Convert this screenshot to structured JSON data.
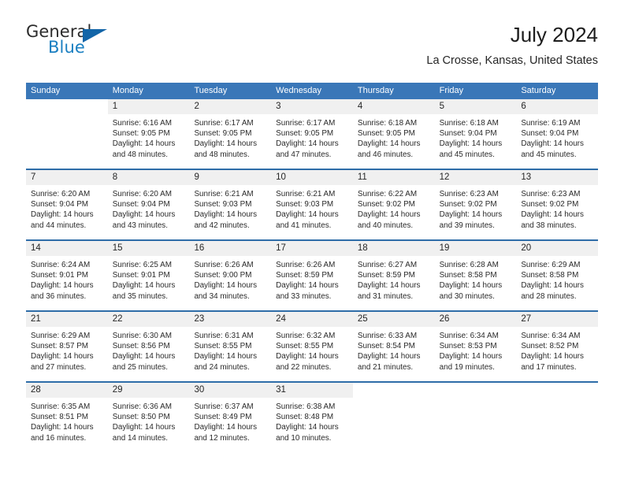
{
  "brand": {
    "name_primary": "General",
    "name_secondary": "Blue",
    "logo_icon": "triangle-logo-icon"
  },
  "header": {
    "title": "July 2024",
    "subtitle": "La Crosse, Kansas, United States"
  },
  "colors": {
    "header_blue": "#3a77b8",
    "row_divider_blue": "#2e6da8",
    "day_band_gray": "#f0f0f0",
    "logo_blue": "#1a7fc1",
    "text_dark": "#262626"
  },
  "weekdays": [
    "Sunday",
    "Monday",
    "Tuesday",
    "Wednesday",
    "Thursday",
    "Friday",
    "Saturday"
  ],
  "weeks": [
    {
      "days": [
        {
          "number": "",
          "blank": true,
          "lines": []
        },
        {
          "number": "1",
          "blank": false,
          "lines": [
            "Sunrise: 6:16 AM",
            "Sunset: 9:05 PM",
            "Daylight: 14 hours",
            "and 48 minutes."
          ]
        },
        {
          "number": "2",
          "blank": false,
          "lines": [
            "Sunrise: 6:17 AM",
            "Sunset: 9:05 PM",
            "Daylight: 14 hours",
            "and 48 minutes."
          ]
        },
        {
          "number": "3",
          "blank": false,
          "lines": [
            "Sunrise: 6:17 AM",
            "Sunset: 9:05 PM",
            "Daylight: 14 hours",
            "and 47 minutes."
          ]
        },
        {
          "number": "4",
          "blank": false,
          "lines": [
            "Sunrise: 6:18 AM",
            "Sunset: 9:05 PM",
            "Daylight: 14 hours",
            "and 46 minutes."
          ]
        },
        {
          "number": "5",
          "blank": false,
          "lines": [
            "Sunrise: 6:18 AM",
            "Sunset: 9:04 PM",
            "Daylight: 14 hours",
            "and 45 minutes."
          ]
        },
        {
          "number": "6",
          "blank": false,
          "lines": [
            "Sunrise: 6:19 AM",
            "Sunset: 9:04 PM",
            "Daylight: 14 hours",
            "and 45 minutes."
          ]
        }
      ]
    },
    {
      "days": [
        {
          "number": "7",
          "blank": false,
          "lines": [
            "Sunrise: 6:20 AM",
            "Sunset: 9:04 PM",
            "Daylight: 14 hours",
            "and 44 minutes."
          ]
        },
        {
          "number": "8",
          "blank": false,
          "lines": [
            "Sunrise: 6:20 AM",
            "Sunset: 9:04 PM",
            "Daylight: 14 hours",
            "and 43 minutes."
          ]
        },
        {
          "number": "9",
          "blank": false,
          "lines": [
            "Sunrise: 6:21 AM",
            "Sunset: 9:03 PM",
            "Daylight: 14 hours",
            "and 42 minutes."
          ]
        },
        {
          "number": "10",
          "blank": false,
          "lines": [
            "Sunrise: 6:21 AM",
            "Sunset: 9:03 PM",
            "Daylight: 14 hours",
            "and 41 minutes."
          ]
        },
        {
          "number": "11",
          "blank": false,
          "lines": [
            "Sunrise: 6:22 AM",
            "Sunset: 9:02 PM",
            "Daylight: 14 hours",
            "and 40 minutes."
          ]
        },
        {
          "number": "12",
          "blank": false,
          "lines": [
            "Sunrise: 6:23 AM",
            "Sunset: 9:02 PM",
            "Daylight: 14 hours",
            "and 39 minutes."
          ]
        },
        {
          "number": "13",
          "blank": false,
          "lines": [
            "Sunrise: 6:23 AM",
            "Sunset: 9:02 PM",
            "Daylight: 14 hours",
            "and 38 minutes."
          ]
        }
      ]
    },
    {
      "days": [
        {
          "number": "14",
          "blank": false,
          "lines": [
            "Sunrise: 6:24 AM",
            "Sunset: 9:01 PM",
            "Daylight: 14 hours",
            "and 36 minutes."
          ]
        },
        {
          "number": "15",
          "blank": false,
          "lines": [
            "Sunrise: 6:25 AM",
            "Sunset: 9:01 PM",
            "Daylight: 14 hours",
            "and 35 minutes."
          ]
        },
        {
          "number": "16",
          "blank": false,
          "lines": [
            "Sunrise: 6:26 AM",
            "Sunset: 9:00 PM",
            "Daylight: 14 hours",
            "and 34 minutes."
          ]
        },
        {
          "number": "17",
          "blank": false,
          "lines": [
            "Sunrise: 6:26 AM",
            "Sunset: 8:59 PM",
            "Daylight: 14 hours",
            "and 33 minutes."
          ]
        },
        {
          "number": "18",
          "blank": false,
          "lines": [
            "Sunrise: 6:27 AM",
            "Sunset: 8:59 PM",
            "Daylight: 14 hours",
            "and 31 minutes."
          ]
        },
        {
          "number": "19",
          "blank": false,
          "lines": [
            "Sunrise: 6:28 AM",
            "Sunset: 8:58 PM",
            "Daylight: 14 hours",
            "and 30 minutes."
          ]
        },
        {
          "number": "20",
          "blank": false,
          "lines": [
            "Sunrise: 6:29 AM",
            "Sunset: 8:58 PM",
            "Daylight: 14 hours",
            "and 28 minutes."
          ]
        }
      ]
    },
    {
      "days": [
        {
          "number": "21",
          "blank": false,
          "lines": [
            "Sunrise: 6:29 AM",
            "Sunset: 8:57 PM",
            "Daylight: 14 hours",
            "and 27 minutes."
          ]
        },
        {
          "number": "22",
          "blank": false,
          "lines": [
            "Sunrise: 6:30 AM",
            "Sunset: 8:56 PM",
            "Daylight: 14 hours",
            "and 25 minutes."
          ]
        },
        {
          "number": "23",
          "blank": false,
          "lines": [
            "Sunrise: 6:31 AM",
            "Sunset: 8:55 PM",
            "Daylight: 14 hours",
            "and 24 minutes."
          ]
        },
        {
          "number": "24",
          "blank": false,
          "lines": [
            "Sunrise: 6:32 AM",
            "Sunset: 8:55 PM",
            "Daylight: 14 hours",
            "and 22 minutes."
          ]
        },
        {
          "number": "25",
          "blank": false,
          "lines": [
            "Sunrise: 6:33 AM",
            "Sunset: 8:54 PM",
            "Daylight: 14 hours",
            "and 21 minutes."
          ]
        },
        {
          "number": "26",
          "blank": false,
          "lines": [
            "Sunrise: 6:34 AM",
            "Sunset: 8:53 PM",
            "Daylight: 14 hours",
            "and 19 minutes."
          ]
        },
        {
          "number": "27",
          "blank": false,
          "lines": [
            "Sunrise: 6:34 AM",
            "Sunset: 8:52 PM",
            "Daylight: 14 hours",
            "and 17 minutes."
          ]
        }
      ]
    },
    {
      "days": [
        {
          "number": "28",
          "blank": false,
          "lines": [
            "Sunrise: 6:35 AM",
            "Sunset: 8:51 PM",
            "Daylight: 14 hours",
            "and 16 minutes."
          ]
        },
        {
          "number": "29",
          "blank": false,
          "lines": [
            "Sunrise: 6:36 AM",
            "Sunset: 8:50 PM",
            "Daylight: 14 hours",
            "and 14 minutes."
          ]
        },
        {
          "number": "30",
          "blank": false,
          "lines": [
            "Sunrise: 6:37 AM",
            "Sunset: 8:49 PM",
            "Daylight: 14 hours",
            "and 12 minutes."
          ]
        },
        {
          "number": "31",
          "blank": false,
          "lines": [
            "Sunrise: 6:38 AM",
            "Sunset: 8:48 PM",
            "Daylight: 14 hours",
            "and 10 minutes."
          ]
        },
        {
          "number": "",
          "blank": true,
          "lines": []
        },
        {
          "number": "",
          "blank": true,
          "lines": []
        },
        {
          "number": "",
          "blank": true,
          "lines": []
        }
      ]
    }
  ]
}
